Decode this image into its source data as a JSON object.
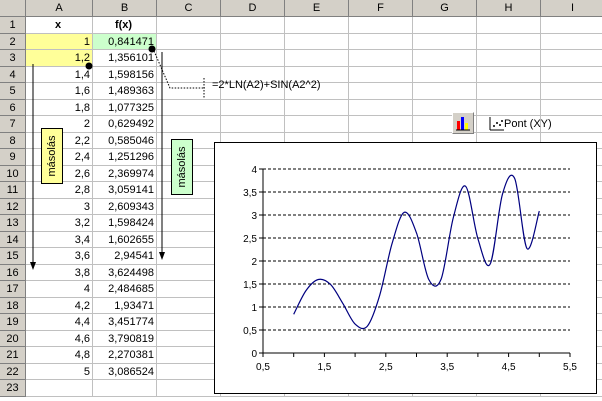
{
  "columns": [
    "A",
    "B",
    "C",
    "D",
    "E",
    "F",
    "G",
    "H",
    "I"
  ],
  "rows": [
    "1",
    "2",
    "3",
    "4",
    "5",
    "6",
    "7",
    "8",
    "9",
    "10",
    "11",
    "12",
    "13",
    "14",
    "15",
    "16",
    "17",
    "18",
    "19",
    "20",
    "21",
    "22",
    "23"
  ],
  "table": {
    "header_x": "x",
    "header_fx": "f(x)",
    "x_values": [
      "1",
      "1,2",
      "1,4",
      "1,6",
      "1,8",
      "2",
      "2,2",
      "2,4",
      "2,6",
      "2,8",
      "3",
      "3,2",
      "3,4",
      "3,6",
      "3,8",
      "4",
      "4,2",
      "4,4",
      "4,6",
      "4,8",
      "5"
    ],
    "fx_values": [
      "0,841471",
      "1,356101",
      "1,598156",
      "1,489363",
      "1,077325",
      "0,629492",
      "0,585046",
      "1,251296",
      "2,369974",
      "3,059141",
      "2,609343",
      "1,598424",
      "1,602655",
      "2,94541",
      "3,624498",
      "2,484685",
      "1,93471",
      "3,451774",
      "3,790819",
      "2,270381",
      "3,086524"
    ]
  },
  "annotations": {
    "copy_label_a": "másolás",
    "copy_label_b": "másolás",
    "formula": "=2*LN(A2)+SIN(A2^2)"
  },
  "toolbar": {
    "chart_type_label": "Pont (XY)"
  },
  "colors": {
    "yellow": "#ffff99",
    "green": "#ccffcc",
    "line": "#000080"
  },
  "chart_data": {
    "type": "scatter",
    "series": [
      {
        "x": [
          1,
          1.2,
          1.4,
          1.6,
          1.8,
          2,
          2.2,
          2.4,
          2.6,
          2.8,
          3,
          3.2,
          3.4,
          3.6,
          3.8,
          4,
          4.2,
          4.4,
          4.6,
          4.8,
          5
        ],
        "values": [
          0.841471,
          1.356101,
          1.598156,
          1.489363,
          1.077325,
          0.629492,
          0.585046,
          1.251296,
          2.369974,
          3.059141,
          2.609343,
          1.598424,
          1.602655,
          2.94541,
          3.624498,
          2.484685,
          1.93471,
          3.451774,
          3.790819,
          2.270381,
          3.086524
        ]
      }
    ],
    "xlim": [
      0.5,
      5.5
    ],
    "ylim": [
      0,
      4
    ],
    "xticks": [
      "0,5",
      "1,5",
      "2,5",
      "3,5",
      "4,5",
      "5,5"
    ],
    "yticks": [
      "0",
      "0,5",
      "1",
      "1,5",
      "2",
      "2,5",
      "3",
      "3,5",
      "4"
    ],
    "grid": "horizontal dashed",
    "smoothed": true
  }
}
